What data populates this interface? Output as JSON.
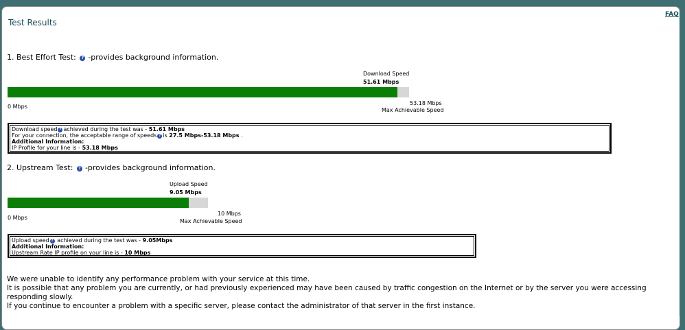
{
  "page": {
    "title": "Test Results",
    "faq": "FAQ"
  },
  "download": {
    "heading": "1. Best Effort Test:",
    "heading_suffix": "-provides background information.",
    "speed_label": "Download Speed",
    "speed_value": "51.61 Mbps",
    "min_label": "0 Mbps",
    "max_value": "53.18 Mbps",
    "max_label": "Max Achievable Speed",
    "fill_fraction": 0.9705,
    "info": {
      "line1_prefix": "Download speed",
      "line1_mid": "achieved during the test was - ",
      "line1_value": "51.61 Mbps",
      "line2_prefix": "For your connection, the acceptable range of speeds",
      "line2_mid": "is ",
      "line2_value": "27.5 Mbps-53.18 Mbps",
      "line2_suffix": " .",
      "line3": "Additional Information:",
      "line4_prefix": "IP Profile for your line is - ",
      "line4_value": "53.18 Mbps"
    }
  },
  "upload": {
    "heading": "2. Upstream Test:",
    "heading_suffix": "-provides background information.",
    "speed_label": "Upload Speed",
    "speed_value": "9.05 Mbps",
    "min_label": "0 Mbps",
    "max_value": "10 Mbps",
    "max_label": "Max Achievable Speed",
    "fill_fraction": 0.905,
    "info": {
      "line1_prefix": "Upload speed",
      "line1_mid": " achieved during the test was - ",
      "line1_value": "9.05Mbps",
      "line2": "Additional Information:",
      "line3_prefix": "Upstream Rate IP profile on your line is - ",
      "line3_value": "10 Mbps"
    }
  },
  "footer": {
    "line1": "We were unable to identify any performance problem with your service at this time.",
    "line2": "It is possible that any problem you are currently, or had previously experienced may have been caused by traffic congestion on the Internet or by the server you were accessing",
    "line3": "responding slowly.",
    "line4": "If you continue to encounter a problem with a specific server, please contact the administrator of that server in the first instance."
  },
  "colors": {
    "bar_fill": "#0a7e07",
    "bar_track": "#d7d7d7",
    "header": "#3f6f72",
    "help_icon": "#2b4fa8"
  }
}
